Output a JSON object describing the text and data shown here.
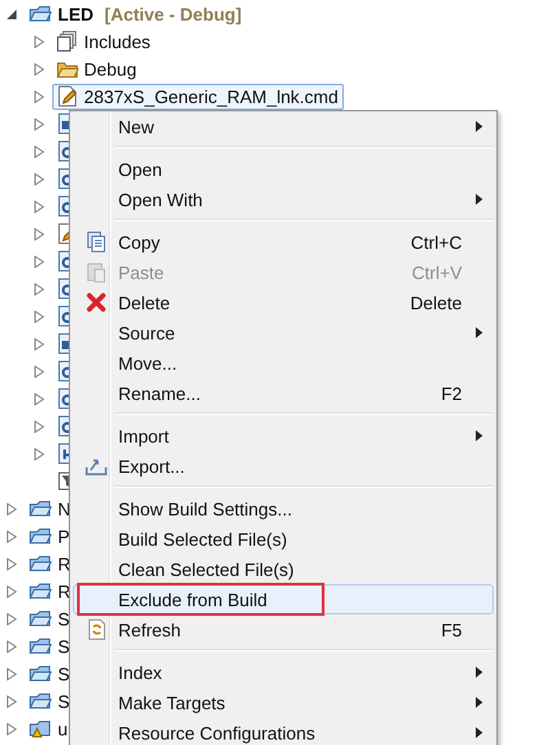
{
  "tree": [
    {
      "kind": "project",
      "label": "LED",
      "badge": "[Active - Debug]",
      "expanded": true,
      "children": [
        {
          "kind": "includes",
          "label": "Includes",
          "expanded": false,
          "selected": false
        },
        {
          "kind": "folder",
          "label": "Debug",
          "expanded": false,
          "selected": false
        },
        {
          "kind": "cmd",
          "label": "2837xS_Generic_RAM_lnk.cmd",
          "expanded": false,
          "selected": true
        },
        {
          "kind": "asm",
          "expanded": false,
          "selected": false
        },
        {
          "kind": "c",
          "expanded": false,
          "selected": false
        },
        {
          "kind": "c",
          "expanded": false,
          "selected": false
        },
        {
          "kind": "c",
          "expanded": false,
          "selected": false
        },
        {
          "kind": "cmd",
          "expanded": false,
          "selected": false
        },
        {
          "kind": "c",
          "expanded": false,
          "selected": false
        },
        {
          "kind": "c",
          "expanded": false,
          "selected": false
        },
        {
          "kind": "c",
          "expanded": false,
          "selected": false
        },
        {
          "kind": "asm",
          "expanded": false,
          "selected": false
        },
        {
          "kind": "c",
          "expanded": false,
          "selected": false
        },
        {
          "kind": "c",
          "expanded": false,
          "selected": false
        },
        {
          "kind": "c",
          "expanded": false,
          "selected": false
        },
        {
          "kind": "header",
          "expanded": false,
          "selected": false
        },
        {
          "kind": "filter",
          "selected": false
        }
      ]
    },
    {
      "kind": "project",
      "label": "N",
      "expanded": false
    },
    {
      "kind": "project",
      "label": "P",
      "expanded": false
    },
    {
      "kind": "project",
      "label": "R",
      "expanded": false
    },
    {
      "kind": "project",
      "label": "R",
      "expanded": false
    },
    {
      "kind": "project",
      "label": "S",
      "expanded": false
    },
    {
      "kind": "project",
      "label": "S",
      "expanded": false
    },
    {
      "kind": "project",
      "label": "S",
      "expanded": false
    },
    {
      "kind": "project",
      "label": "S",
      "expanded": false
    },
    {
      "kind": "project-warning",
      "label": "u",
      "expanded": false
    }
  ],
  "context_menu": [
    {
      "kind": "item",
      "label": "New",
      "submenu": true,
      "disabled": false,
      "selected": false
    },
    {
      "kind": "separator"
    },
    {
      "kind": "item",
      "label": "Open",
      "submenu": false,
      "disabled": false,
      "selected": false
    },
    {
      "kind": "item",
      "label": "Open With",
      "submenu": true,
      "disabled": false,
      "selected": false
    },
    {
      "kind": "separator"
    },
    {
      "kind": "copy",
      "label": "Copy",
      "shortcut": "Ctrl+C",
      "submenu": false,
      "disabled": false,
      "selected": false
    },
    {
      "kind": "paste",
      "label": "Paste",
      "shortcut": "Ctrl+V",
      "submenu": false,
      "disabled": true,
      "selected": false
    },
    {
      "kind": "delete",
      "label": "Delete",
      "shortcut": "Delete",
      "submenu": false,
      "disabled": false,
      "selected": false
    },
    {
      "kind": "item",
      "label": "Source",
      "submenu": true,
      "disabled": false,
      "selected": false
    },
    {
      "kind": "item",
      "label": "Move...",
      "submenu": false,
      "disabled": false,
      "selected": false
    },
    {
      "kind": "item",
      "label": "Rename...",
      "shortcut": "F2",
      "submenu": false,
      "disabled": false,
      "selected": false
    },
    {
      "kind": "separator"
    },
    {
      "kind": "item",
      "label": "Import",
      "submenu": true,
      "disabled": false,
      "selected": false
    },
    {
      "kind": "export",
      "label": "Export...",
      "submenu": false,
      "disabled": false,
      "selected": false
    },
    {
      "kind": "separator"
    },
    {
      "kind": "item",
      "label": "Show Build Settings...",
      "submenu": false,
      "disabled": false,
      "selected": false
    },
    {
      "kind": "item",
      "label": "Build Selected File(s)",
      "submenu": false,
      "disabled": false,
      "selected": false
    },
    {
      "kind": "item",
      "label": "Clean Selected File(s)",
      "submenu": false,
      "disabled": false,
      "selected": false
    },
    {
      "kind": "item",
      "label": "Exclude from Build",
      "submenu": false,
      "disabled": false,
      "selected": true,
      "annotated": true
    },
    {
      "kind": "refresh",
      "label": "Refresh",
      "shortcut": "F5",
      "submenu": false,
      "disabled": false,
      "selected": false
    },
    {
      "kind": "separator"
    },
    {
      "kind": "item",
      "label": "Index",
      "submenu": true,
      "disabled": false,
      "selected": false
    },
    {
      "kind": "item",
      "label": "Make Targets",
      "submenu": true,
      "disabled": false,
      "selected": false
    },
    {
      "kind": "item",
      "label": "Resource Configurations",
      "submenu": true,
      "disabled": false,
      "selected": false
    }
  ]
}
